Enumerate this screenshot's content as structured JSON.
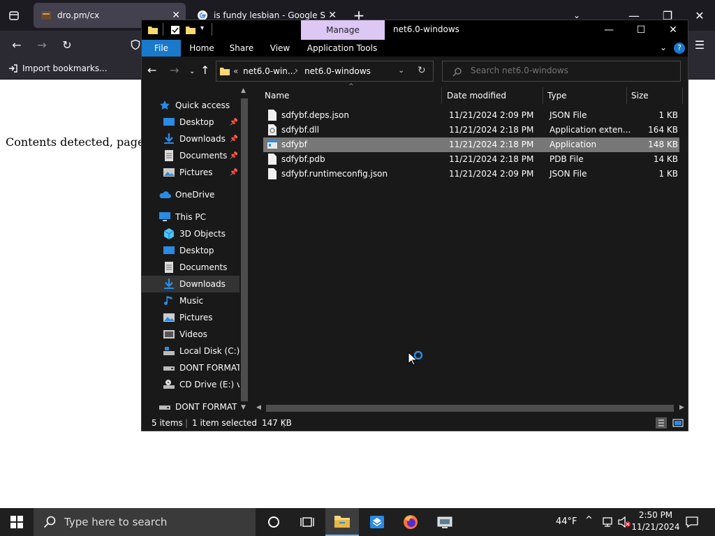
{
  "browser": {
    "tabs": [
      {
        "title": "dro.pm/cx",
        "active": true
      },
      {
        "title": "is fundy lesbian - Google Search",
        "active": false
      }
    ],
    "bookmarks": {
      "import_label": "Import bookmarks..."
    },
    "page_text": "Contents detected, page is be"
  },
  "explorer": {
    "ribbon_context_tab": "Manage",
    "title": "net6.0-windows",
    "ribbon_tabs": [
      "File",
      "Home",
      "Share",
      "View",
      "Application Tools"
    ],
    "address": {
      "prefix": "«",
      "crumbs": [
        "net6.0-win...",
        "net6.0-windows"
      ]
    },
    "search_placeholder": "Search net6.0-windows",
    "nav": {
      "quick_access": "Quick access",
      "quick_items": [
        "Desktop",
        "Downloads",
        "Documents",
        "Pictures"
      ],
      "onedrive": "OneDrive",
      "this_pc": "This PC",
      "pc_items": [
        "3D Objects",
        "Desktop",
        "Documents",
        "Downloads",
        "Music",
        "Pictures",
        "Videos",
        "Local Disk (C:)",
        "DONT FORMAT (",
        "CD Drive (E:) virt"
      ],
      "bottom_item": "DONT FORMAT (D"
    },
    "columns": {
      "name": "Name",
      "date": "Date modified",
      "type": "Type",
      "size": "Size"
    },
    "files": [
      {
        "name": "sdfybf.deps.json",
        "date": "11/21/2024 2:09 PM",
        "type": "JSON File",
        "size": "1 KB",
        "selected": false
      },
      {
        "name": "sdfybf.dll",
        "date": "11/21/2024 2:18 PM",
        "type": "Application exten...",
        "size": "164 KB",
        "selected": false
      },
      {
        "name": "sdfybf",
        "date": "11/21/2024 2:18 PM",
        "type": "Application",
        "size": "148 KB",
        "selected": true
      },
      {
        "name": "sdfybf.pdb",
        "date": "11/21/2024 2:18 PM",
        "type": "PDB File",
        "size": "14 KB",
        "selected": false
      },
      {
        "name": "sdfybf.runtimeconfig.json",
        "date": "11/21/2024 2:09 PM",
        "type": "JSON File",
        "size": "1 KB",
        "selected": false
      }
    ],
    "status": {
      "items": "5 items",
      "selected": "1 item selected",
      "size": "147 KB"
    }
  },
  "taskbar": {
    "search_placeholder": "Type here to search",
    "weather": "44°F",
    "time": "2:50 PM",
    "date": "11/21/2024"
  },
  "colors": {
    "accent": "#1979ca",
    "manage_tab": "#dcc7f5",
    "folder": "#f8d775"
  }
}
